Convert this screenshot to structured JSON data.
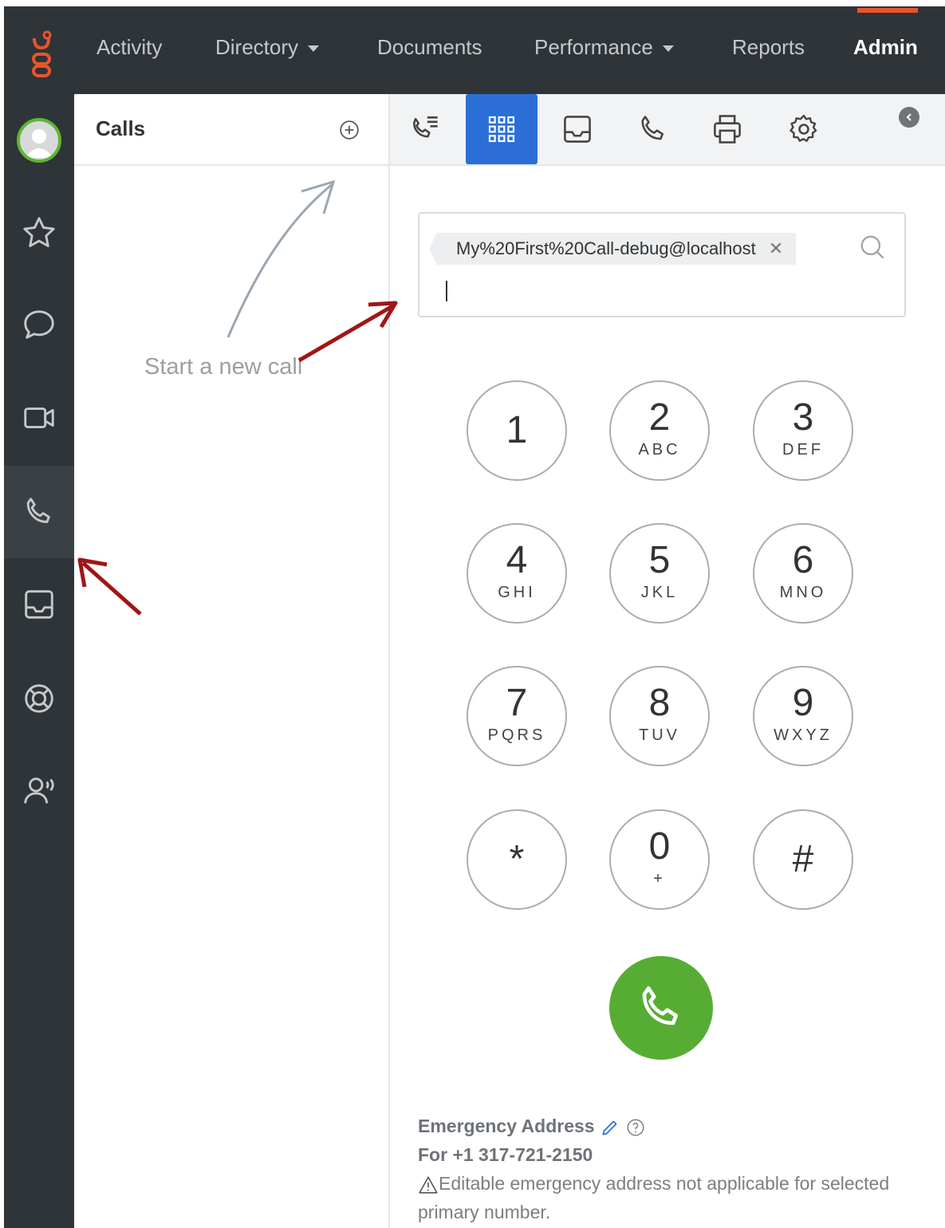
{
  "nav": {
    "items": [
      "Activity",
      "Directory",
      "Documents",
      "Performance",
      "Reports",
      "Admin"
    ],
    "active": "Admin"
  },
  "sidebar": {
    "icons": [
      "avatar",
      "star-icon",
      "chat-icon",
      "video-icon",
      "phone-icon",
      "inbox-icon",
      "support-icon",
      "queue-activation-icon"
    ],
    "active": "phone-icon"
  },
  "calls": {
    "title": "Calls",
    "hint": "Start a new call"
  },
  "dialer": {
    "toolbar_icons": [
      "call-list-icon",
      "dialpad-icon",
      "voicemail-icon",
      "phone-icon",
      "fax-icon",
      "settings-icon"
    ],
    "active_tool": "dialpad-icon",
    "chip_text": "My%20First%20Call-debug@localhost",
    "keys": [
      {
        "digit": "1",
        "letters": ""
      },
      {
        "digit": "2",
        "letters": "ABC"
      },
      {
        "digit": "3",
        "letters": "DEF"
      },
      {
        "digit": "4",
        "letters": "GHI"
      },
      {
        "digit": "5",
        "letters": "JKL"
      },
      {
        "digit": "6",
        "letters": "MNO"
      },
      {
        "digit": "7",
        "letters": "PQRS"
      },
      {
        "digit": "8",
        "letters": "TUV"
      },
      {
        "digit": "9",
        "letters": "WXYZ"
      },
      {
        "digit": "*",
        "letters": ""
      },
      {
        "digit": "0",
        "letters": "+"
      },
      {
        "digit": "#",
        "letters": ""
      }
    ],
    "call_button_color": "#57ad33"
  },
  "emergency": {
    "title": "Emergency Address",
    "for_number": "For +1 317-721-2150",
    "warning": "Editable emergency address not applicable for selected primary number."
  },
  "colors": {
    "topbar": "#2f3438",
    "accent_blue": "#2b6fd6",
    "accent_orange": "#e8552a",
    "annotation_red": "#a01616"
  }
}
